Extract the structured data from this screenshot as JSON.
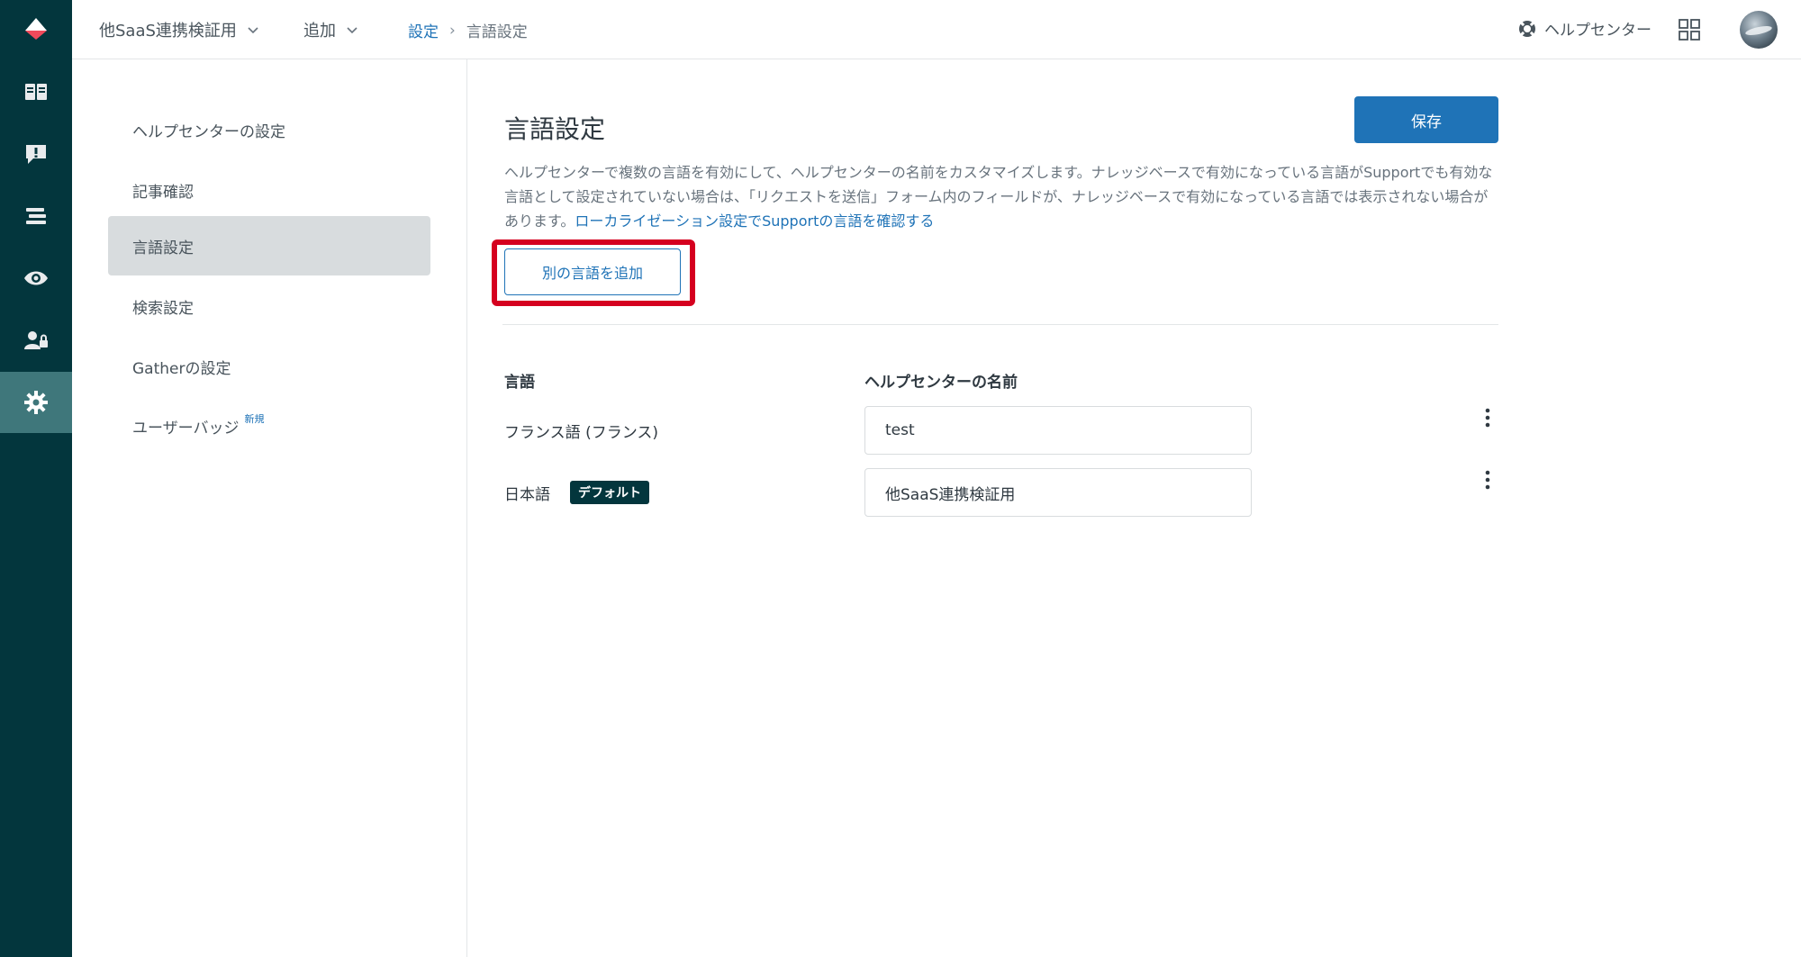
{
  "topbar": {
    "brand": "他SaaS連携検証用",
    "add": "追加",
    "breadcrumb": {
      "parent": "設定",
      "separator": "›",
      "current": "言語設定"
    },
    "help_center": "ヘルプセンター"
  },
  "product_nav": {
    "icons": [
      "zendesk-logo-icon",
      "book-icon",
      "feedback-alert-icon",
      "list-icon",
      "eye-icon",
      "user-lock-icon",
      "gear-icon"
    ],
    "active_index": 6
  },
  "settings_nav": {
    "items": [
      {
        "label": "ヘルプセンターの設定"
      },
      {
        "label": "記事確認"
      },
      {
        "label": "言語設定"
      },
      {
        "label": "検索設定"
      },
      {
        "label": "Gatherの設定"
      },
      {
        "label": "ユーザーバッジ",
        "badge": "新規"
      }
    ],
    "active_index": 2
  },
  "main": {
    "title": "言語設定",
    "save_label": "保存",
    "description_text": "ヘルプセンターで複数の言語を有効にして、ヘルプセンターの名前をカスタマイズします。ナレッジベースで有効になっている言語がSupportでも有効な言語として設定されていない場合は、「リクエストを送信」フォーム内のフィールドが、ナレッジベースで有効になっている言語では表示されない場合があります。",
    "description_link": "ローカライゼーション設定でSupportの言語を確認する",
    "add_language_label": "別の言語を追加",
    "columns": {
      "language": "言語",
      "help_center_name": "ヘルプセンターの名前"
    },
    "rows": [
      {
        "language": "フランス語 (フランス)",
        "name": "test"
      },
      {
        "language": "日本語",
        "badge": "デフォルト",
        "name": "他SaaS連携検証用"
      }
    ]
  },
  "colors": {
    "nav_bg": "#03363d",
    "nav_active": "#3f777b",
    "primary": "#1f73b7",
    "highlight": "#d5001f"
  }
}
